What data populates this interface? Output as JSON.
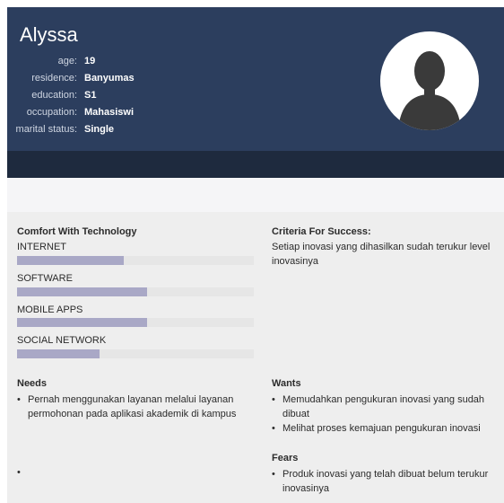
{
  "persona": {
    "name": "Alyssa",
    "info": [
      {
        "key": "age:",
        "value": "19"
      },
      {
        "key": "residence:",
        "value": "Banyumas"
      },
      {
        "key": "education:",
        "value": "S1"
      },
      {
        "key": "occupation:",
        "value": "Mahasiswi"
      },
      {
        "key": "marital status:",
        "value": "Single"
      }
    ],
    "avatar_icon": "person-silhouette-icon"
  },
  "comfort": {
    "title": "Comfort With Technology",
    "items": [
      {
        "label": "INTERNET",
        "level": 0.45
      },
      {
        "label": "SOFTWARE",
        "level": 0.55
      },
      {
        "label": "MOBILE APPS",
        "level": 0.55
      },
      {
        "label": "SOCIAL NETWORK",
        "level": 0.35
      }
    ]
  },
  "criteria": {
    "title": "Criteria For Success:",
    "text": "Setiap inovasi yang dihasilkan sudah terukur level inovasinya"
  },
  "needs": {
    "title": "Needs",
    "items": [
      "Pernah menggunakan layanan melalui layanan permohonan pada aplikasi akademik di kampus"
    ],
    "extra_bullet": "•"
  },
  "wants": {
    "title": "Wants",
    "items": [
      "Memudahkan pengukuran inovasi yang sudah dibuat",
      "Melihat proses kemajuan pengukuran inovasi"
    ]
  },
  "fears": {
    "title": "Fears",
    "items": [
      "Produk inovasi yang telah dibuat belum terukur inovasinya"
    ]
  },
  "colors": {
    "header": "#2c3e5e",
    "header_band": "#1e2a3e",
    "bar_fill": "#a9a8c6",
    "bar_track": "#e6e6e6",
    "content_bg": "#eeeeee"
  }
}
